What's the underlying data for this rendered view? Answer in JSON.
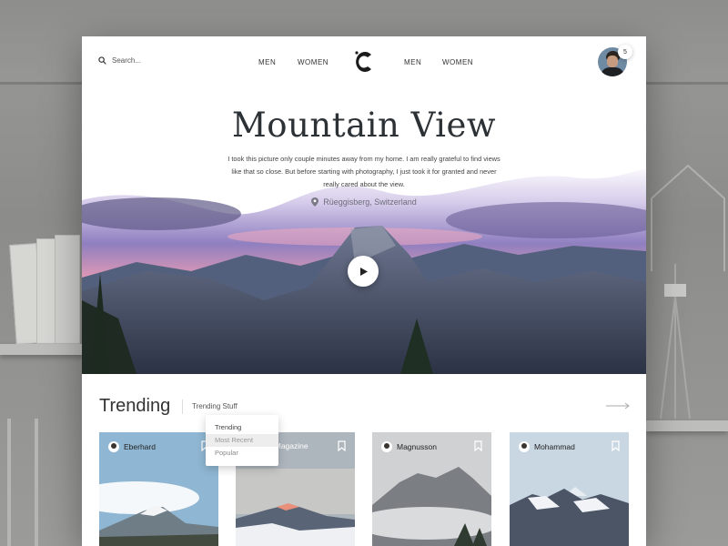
{
  "nav": {
    "search_placeholder": "Search...",
    "left_links": [
      "MEN",
      "WOMEN"
    ],
    "right_links": [
      "MEN",
      "WOMEN"
    ],
    "notification_count": "5"
  },
  "hero": {
    "title": "Mountain View",
    "description": "I took this picture only couple minutes away from my home. I am really grateful to find views like that so close. But before starting with photography, I just took it for granted and never really cared about the view.",
    "location": "Rüeggisberg, Switzerland"
  },
  "trending": {
    "title": "Trending",
    "filter_label": "Trending Stuff",
    "dropdown_options": [
      "Trending",
      "Most Recent",
      "Popular"
    ],
    "selected_option": "Most Recent",
    "cards": [
      {
        "author": "Eberhard"
      },
      {
        "author": "Backsack Magazine"
      },
      {
        "author": "Magnusson"
      },
      {
        "author": "Mohammad"
      }
    ]
  },
  "icons": {
    "search": "search-icon",
    "location": "location-pin-icon",
    "play": "play-icon",
    "arrow": "arrow-right-icon",
    "bookmark": "bookmark-icon",
    "logo": "brand-logo"
  },
  "colors": {
    "title": "#2c3136",
    "location": "#6d6d7a",
    "sky_purple": "#7a6aa8",
    "sky_pink": "#e79ab7"
  }
}
